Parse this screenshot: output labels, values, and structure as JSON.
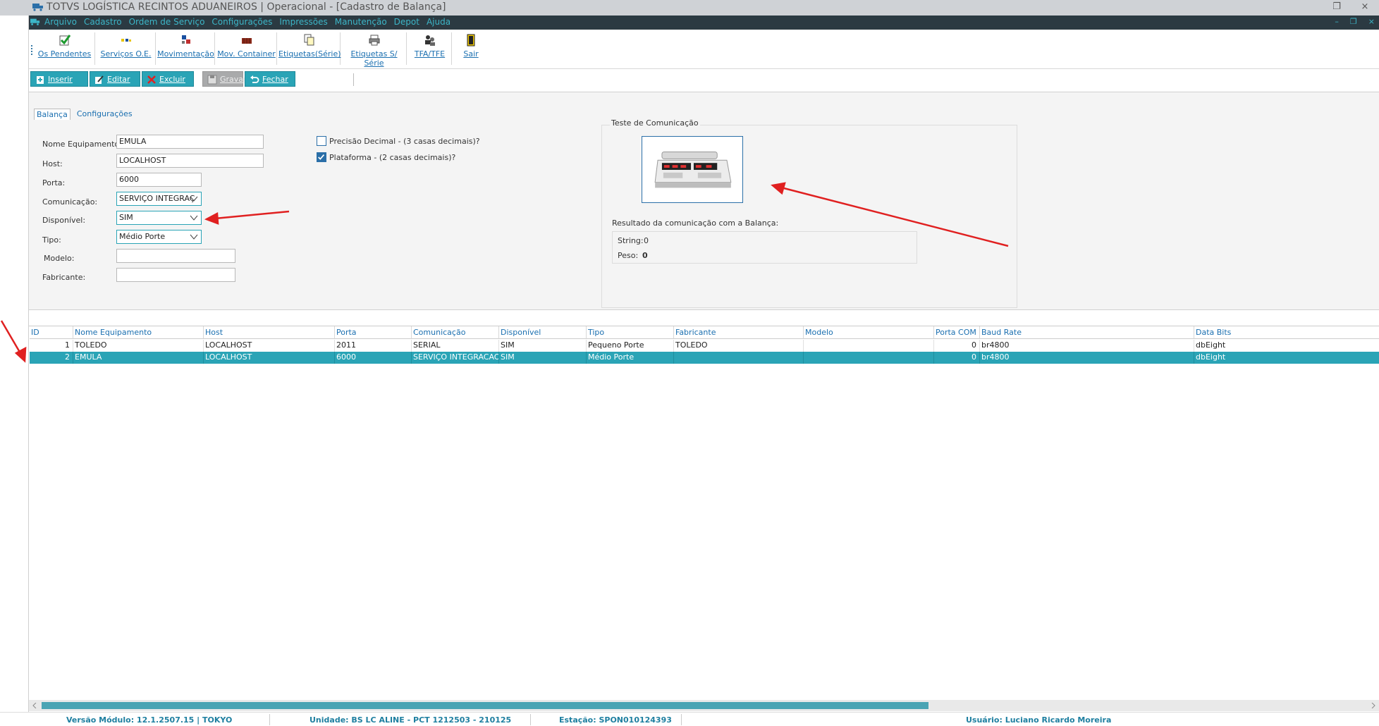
{
  "window": {
    "title": "TOTVS LOGÍSTICA RECINTOS ADUANEIROS | Operacional - [Cadastro de Balança]",
    "close_glyph": "×",
    "restore_glyph": "❐"
  },
  "menu": {
    "items": [
      "Arquivo",
      "Cadastro",
      "Ordem de Serviço",
      "Configurações",
      "Impressões",
      "Manutenção",
      "Depot",
      "Ajuda"
    ],
    "right": [
      "–",
      "❐",
      "×"
    ]
  },
  "toolbar": {
    "items": [
      {
        "label": "Os Pendentes",
        "icon": "check-icon"
      },
      {
        "label": "Serviços O.E.",
        "icon": "tools-icon"
      },
      {
        "label": "Movimentação",
        "icon": "move-icon"
      },
      {
        "label": "Mov. Container",
        "icon": "container-icon"
      },
      {
        "label": "Etiquetas(Série)",
        "icon": "labels-icon"
      },
      {
        "label": "Etiquetas S/ Série",
        "icon": "printer-icon"
      },
      {
        "label": "TFA/TFE",
        "icon": "people-icon"
      },
      {
        "label": "Sair",
        "icon": "exit-door-icon"
      }
    ]
  },
  "actions": {
    "insert": "Inserir",
    "edit": "Editar",
    "delete": "Excluir",
    "save": "Gravar",
    "close": "Fechar"
  },
  "tabs": [
    "Balança",
    "Configurações"
  ],
  "form": {
    "nome_label": "Nome Equipamento:",
    "nome_value": "EMULA",
    "host_label": "Host:",
    "host_value": "LOCALHOST",
    "porta_label": "Porta:",
    "porta_value": "6000",
    "comunicacao_label": "Comunicação:",
    "comunicacao_value": "SERVIÇO INTEGRAÇ",
    "disponivel_label": "Disponível:",
    "disponivel_value": "SIM",
    "tipo_label": "Tipo:",
    "tipo_value": "Médio Porte",
    "modelo_label": "Modelo:",
    "modelo_value": "",
    "fabricante_label": "Fabricante:",
    "fabricante_value": "",
    "precisao_label": "Precisão Decimal - (3 casas decimais)?",
    "precisao_checked": false,
    "plataforma_label": "Plataforma - (2 casas decimais)?",
    "plataforma_checked": true
  },
  "test": {
    "title": "Teste de Comunicação",
    "result_label": "Resultado da comunicação com a Balança:",
    "string_label": "String:",
    "string_value": "0",
    "peso_label": "Peso:",
    "peso_value": "0"
  },
  "grid": {
    "headers": [
      "ID",
      "Nome Equipamento",
      "Host",
      "Porta",
      "Comunicação",
      "Disponível",
      "Tipo",
      "Fabricante",
      "Modelo",
      "Porta COM",
      "Baud Rate",
      "Data Bits"
    ],
    "rows": [
      [
        "1",
        "TOLEDO",
        "LOCALHOST",
        "2011",
        "SERIAL",
        "SIM",
        "Pequeno Porte",
        "TOLEDO",
        "",
        "0",
        "br4800",
        "dbEight"
      ],
      [
        "2",
        "EMULA",
        "LOCALHOST",
        "6000",
        "SERVIÇO INTEGRACAO",
        "SIM",
        "Médio Porte",
        "",
        "",
        "0",
        "br4800",
        "dbEight"
      ]
    ],
    "selected_row": 1
  },
  "status": {
    "versao": "Versão Módulo:  12.1.2507.15  |  TOKYO",
    "unidade": "Unidade: BS LC ALINE - PCT 1212503 - 210125",
    "estacao": "Estação: SPON010124393",
    "usuario": "Usuário: Luciano Ricardo Moreira"
  },
  "colors": {
    "accent": "#2aa4b6",
    "menubar": "#2b3a42",
    "link": "#1a6fb0",
    "arrow": "#e02020"
  }
}
